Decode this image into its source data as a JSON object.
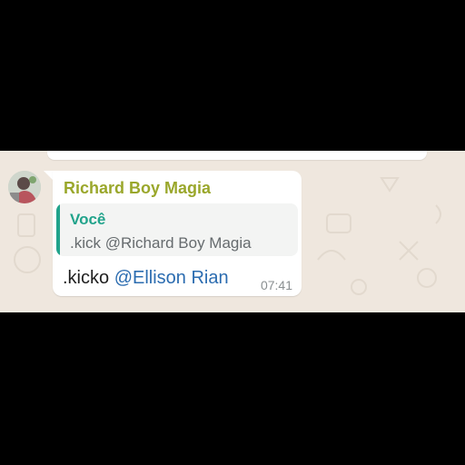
{
  "conversation": {
    "message": {
      "sender_name": "Richard Boy Magia",
      "quoted": {
        "author": "Você",
        "text": ".kick @Richard Boy Magia"
      },
      "text": ".kicko",
      "mention": "@Ellison Rian",
      "time": "07:41"
    }
  },
  "colors": {
    "chat_background": "#efe7de",
    "sender_name": "#9aa72b",
    "quote_accent": "#21a38b",
    "mention": "#2b6cb0",
    "frame": "#000000"
  },
  "icons": {
    "avatar": "user-avatar-photo"
  }
}
